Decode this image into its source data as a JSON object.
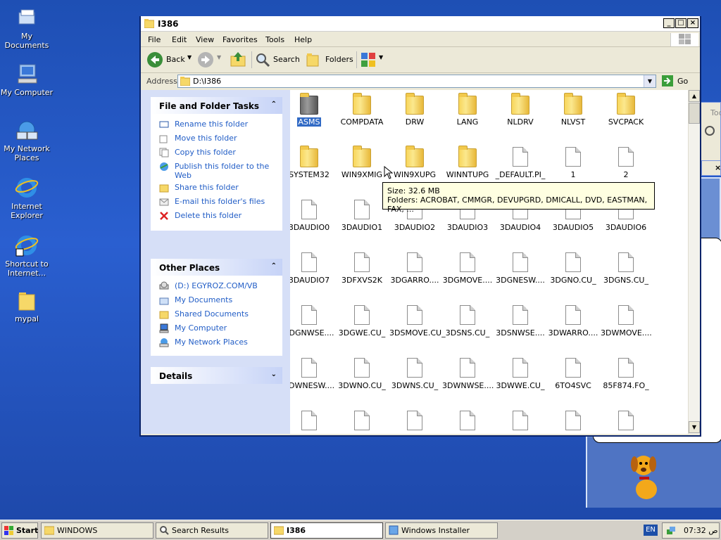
{
  "desktop": {
    "icons": [
      {
        "label": "My Documents",
        "icon": "my-documents-icon"
      },
      {
        "label": "My Computer",
        "icon": "my-computer-icon"
      },
      {
        "label": "My Network Places",
        "icon": "network-places-icon"
      },
      {
        "label": "Internet Explorer",
        "icon": "internet-explorer-icon"
      },
      {
        "label": "Shortcut to Internet...",
        "icon": "internet-shortcut-icon"
      },
      {
        "label": "mypal",
        "icon": "folder-icon"
      }
    ]
  },
  "background_window": {
    "partial_text": "Tod"
  },
  "window": {
    "title": "I386",
    "menu": [
      "File",
      "Edit",
      "View",
      "Favorites",
      "Tools",
      "Help"
    ],
    "toolbar": {
      "back": "Back",
      "search": "Search",
      "folders": "Folders"
    },
    "address": {
      "label": "Address",
      "value": "D:\\I386",
      "go": "Go"
    }
  },
  "left_pane": {
    "file_tasks": {
      "title": "File and Folder Tasks",
      "items": [
        {
          "label": "Rename this folder",
          "icon": "rename-icon"
        },
        {
          "label": "Move this folder",
          "icon": "move-icon"
        },
        {
          "label": "Copy this folder",
          "icon": "copy-icon"
        },
        {
          "label": "Publish this folder to the Web",
          "icon": "publish-web-icon"
        },
        {
          "label": "Share this folder",
          "icon": "share-icon"
        },
        {
          "label": "E-mail this folder's files",
          "icon": "email-icon"
        },
        {
          "label": "Delete this folder",
          "icon": "delete-icon"
        }
      ]
    },
    "other_places": {
      "title": "Other Places",
      "items": [
        {
          "label": "(D:) EGYROZ.COM/VB",
          "icon": "cd-drive-icon"
        },
        {
          "label": "My Documents",
          "icon": "my-documents-icon"
        },
        {
          "label": "Shared Documents",
          "icon": "folder-icon"
        },
        {
          "label": "My Computer",
          "icon": "my-computer-icon"
        },
        {
          "label": "My Network Places",
          "icon": "network-places-icon"
        }
      ]
    },
    "details": {
      "title": "Details"
    }
  },
  "files": [
    {
      "name": "ASMS",
      "type": "folder-gray",
      "selected": true
    },
    {
      "name": "COMPDATA",
      "type": "folder"
    },
    {
      "name": "DRW",
      "type": "folder"
    },
    {
      "name": "LANG",
      "type": "folder"
    },
    {
      "name": "NLDRV",
      "type": "folder"
    },
    {
      "name": "NLVST",
      "type": "folder"
    },
    {
      "name": "SVCPACK",
      "type": "folder"
    },
    {
      "name": "SYSTEM32",
      "type": "folder"
    },
    {
      "name": "WIN9XMIG",
      "type": "folder"
    },
    {
      "name": "WIN9XUPG",
      "type": "folder"
    },
    {
      "name": "WINNTUPG",
      "type": "folder"
    },
    {
      "name": "_DEFAULT.PI_",
      "type": "file"
    },
    {
      "name": "1",
      "type": "file"
    },
    {
      "name": "2",
      "type": "file"
    },
    {
      "name": "3DAUDIO0",
      "type": "file"
    },
    {
      "name": "3DAUDIO1",
      "type": "file"
    },
    {
      "name": "3DAUDIO2",
      "type": "file"
    },
    {
      "name": "3DAUDIO3",
      "type": "file"
    },
    {
      "name": "3DAUDIO4",
      "type": "file"
    },
    {
      "name": "3DAUDIO5",
      "type": "file"
    },
    {
      "name": "3DAUDIO6",
      "type": "file"
    },
    {
      "name": "3DAUDIO7",
      "type": "file"
    },
    {
      "name": "3DFXVS2K",
      "type": "file"
    },
    {
      "name": "3DGARRO....",
      "type": "file"
    },
    {
      "name": "3DGMOVE....",
      "type": "file"
    },
    {
      "name": "3DGNESW....",
      "type": "file"
    },
    {
      "name": "3DGNO.CU_",
      "type": "file"
    },
    {
      "name": "3DGNS.CU_",
      "type": "file"
    },
    {
      "name": "3DGNWSE....",
      "type": "file"
    },
    {
      "name": "3DGWE.CU_",
      "type": "file"
    },
    {
      "name": "3DSMOVE.CU_",
      "type": "file"
    },
    {
      "name": "3DSNS.CU_",
      "type": "file"
    },
    {
      "name": "3DSNWSE....",
      "type": "file"
    },
    {
      "name": "3DWARRO....",
      "type": "file"
    },
    {
      "name": "3DWMOVE....",
      "type": "file"
    },
    {
      "name": "3DWNESW....",
      "type": "file"
    },
    {
      "name": "3DWNO.CU_",
      "type": "file"
    },
    {
      "name": "3DWNS.CU_",
      "type": "file"
    },
    {
      "name": "3DWNWSE....",
      "type": "file"
    },
    {
      "name": "3DWWE.CU_",
      "type": "file"
    },
    {
      "name": "6TO4SVC",
      "type": "file"
    },
    {
      "name": "85F874.FO_",
      "type": "file"
    },
    {
      "name": "",
      "type": "file"
    },
    {
      "name": "",
      "type": "file"
    },
    {
      "name": "",
      "type": "file"
    },
    {
      "name": "",
      "type": "file"
    },
    {
      "name": "",
      "type": "file"
    },
    {
      "name": "",
      "type": "file"
    },
    {
      "name": "",
      "type": "file"
    }
  ],
  "tooltip": {
    "size": "Size: 32.6 MB",
    "folders": "Folders: ACROBAT, CMMGR, DEVUPGRD, DMICALL, DVD, EASTMAN, FAX, ..."
  },
  "taskbar": {
    "start": "Start",
    "buttons": [
      "WINDOWS",
      "Search Results",
      "I386",
      "Windows Installer"
    ],
    "active": "I386",
    "language": "EN",
    "clock": "07:32 ص"
  }
}
